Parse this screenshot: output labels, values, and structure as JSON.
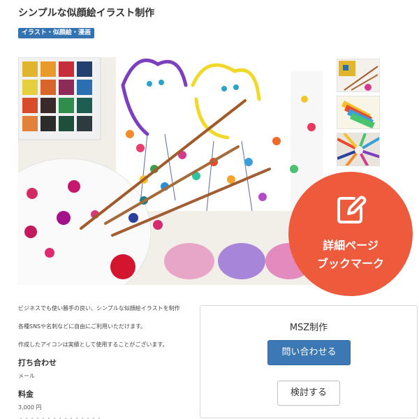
{
  "listing": {
    "title": "シンプルな似顔絵イラスト制作",
    "category": "イラスト・似顔絵・漫画"
  },
  "gallery": {
    "main_image": "watercolor-painting-photo",
    "thumbnails": [
      "brushes-photo",
      "colored-pencils-cup-photo",
      "colored-pencils-circle-photo"
    ]
  },
  "description": {
    "line1": "ビジネスでも使い勝手の良い、シンプルな似顔絵イラストを制作",
    "line2": "各種SNSや名刺などに自由にご利用いただけます。",
    "line3": "作成したアイコンは実績として使用することがございます。"
  },
  "details": {
    "meeting_label": "打ち合わせ",
    "meeting_value": "メール",
    "price_label": "料金",
    "price_value": "3,000 円",
    "more_text": "・・・・・・・・・・・・・・・"
  },
  "seller_card": {
    "seller_name": "MSZ制作",
    "contact_button": "問い合わせる",
    "consider_button": "検討する"
  },
  "bookmark": {
    "icon": "edit-icon",
    "line1": "詳細ページ",
    "line2": "ブックマーク",
    "color": "#ee5a3c"
  },
  "colors": {
    "accent": "#3c78b4",
    "category_badge": "#3572b0"
  }
}
